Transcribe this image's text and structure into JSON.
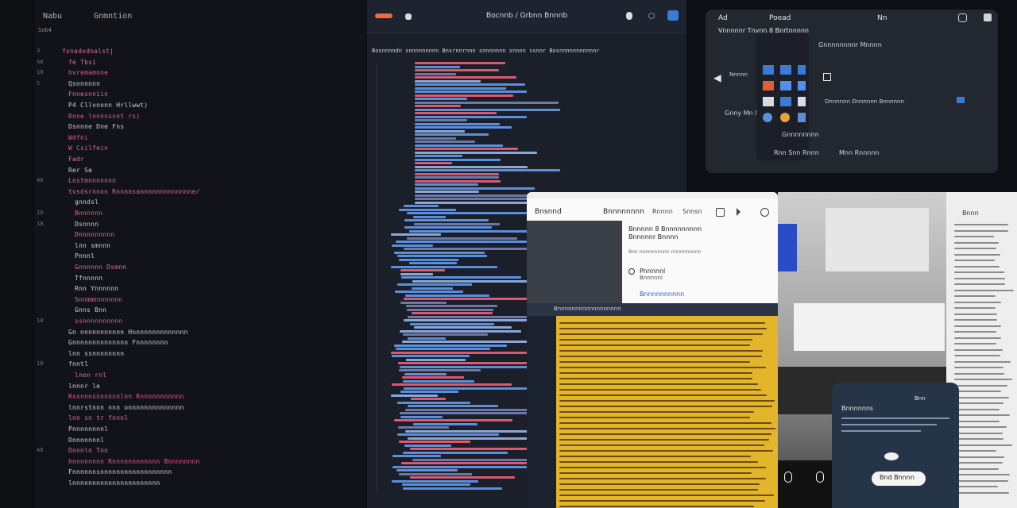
{
  "left_editor": {
    "tabs": [
      "Nabu",
      "Gnmntion"
    ],
    "gutter_top": "Sob4",
    "lines": [
      {
        "ln": "3",
        "t": "fxnadxdnalst|",
        "c": "#d86ca1",
        "i": 0
      },
      {
        "ln": "48",
        "t": "fe Tbsi",
        "c": "#d86ca1",
        "i": 1
      },
      {
        "ln": "18",
        "t": "hvremamnne",
        "c": "#e8578b",
        "i": 1
      },
      {
        "ln": "5",
        "t": "Qsnnnnnn",
        "c": "#c9ccd4",
        "i": 1
      },
      {
        "ln": "",
        "t": "Fnnesnniin",
        "c": "#d86ca1",
        "i": 1
      },
      {
        "ln": "",
        "t": "P4 Cllvnonn Hrllwwt)",
        "c": "#c9ccd4",
        "i": 1
      },
      {
        "ln": "",
        "t": "Rnne lnnnnsnnt rs)",
        "c": "#e8578b",
        "i": 1
      },
      {
        "ln": "",
        "t": "Dsnnne Dne Fns",
        "c": "#c9ccd4",
        "i": 1
      },
      {
        "ln": "",
        "t": "Wdfni",
        "c": "#e8578b",
        "i": 1
      },
      {
        "ln": "",
        "t": "W Csilfecn",
        "c": "#e8578b",
        "i": 1
      },
      {
        "ln": "",
        "t": "Fadr",
        "c": "#d86ca1",
        "i": 1
      },
      {
        "ln": "",
        "t": "Rer Se",
        "c": "#c9ccd4",
        "i": 1
      },
      {
        "ln": "48",
        "t": "Lnstmnnnnnnn",
        "c": "#d86ca1",
        "i": 1
      },
      {
        "ln": "",
        "t": "tvsdsrnnnn Rnnnnsannnnnnnnnnnnne/",
        "c": "#d86ca1",
        "i": 1
      },
      {
        "ln": "",
        "t": "gnndsl",
        "c": "#c9ccd4",
        "i": 2
      },
      {
        "ln": "10",
        "t": "Bnnnnnn",
        "c": "#e8578b",
        "i": 2
      },
      {
        "ln": "18",
        "t": "Dsnnnn",
        "c": "#c9ccd4",
        "i": 2
      },
      {
        "ln": "",
        "t": "Dnnnnnnnnn",
        "c": "#d86ca1",
        "i": 2
      },
      {
        "ln": "",
        "t": "lnn smnnn",
        "c": "#c9ccd4",
        "i": 2
      },
      {
        "ln": "",
        "t": "Pnnnl",
        "c": "#c9ccd4",
        "i": 2
      },
      {
        "ln": "",
        "t": "Gnnnnnn Dsmnn",
        "c": "#d86ca1",
        "i": 2
      },
      {
        "ln": "",
        "t": "Tfnnnnn",
        "c": "#c9ccd4",
        "i": 2
      },
      {
        "ln": "",
        "t": "Rnn Ynnnnnn",
        "c": "#c9ccd4",
        "i": 2
      },
      {
        "ln": "",
        "t": "Snnmmnnnnnnn",
        "c": "#d86ca1",
        "i": 2
      },
      {
        "ln": "",
        "t": "Gnns Bnn",
        "c": "#c9ccd4",
        "i": 2
      },
      {
        "ln": "18",
        "t": "ssnnnnnnnnnn",
        "c": "#e8578b",
        "i": 2
      },
      {
        "ln": "",
        "t": "Gn nnnnnnnnnnn Hnnnnnnnnnnnnnn",
        "c": "#c9ccd4",
        "i": 1
      },
      {
        "ln": "",
        "t": "Gnnnnnnnnnnnnnn Fnnnnnnnn",
        "c": "#c9ccd4",
        "i": 1
      },
      {
        "ln": "",
        "t": "lnn ssnnnnnnnn",
        "c": "#c9ccd4",
        "i": 1
      },
      {
        "ln": "18",
        "t": "fnntl",
        "c": "#c9ccd4",
        "i": 1
      },
      {
        "ln": "",
        "t": "lnen rnl",
        "c": "#d86ca1",
        "i": 2
      },
      {
        "ln": "",
        "t": "lnnnr le",
        "c": "#c9ccd4",
        "i": 1
      },
      {
        "ln": "",
        "t": "Rssnnnsnnnnnnlnn Rnnnnnnnnnnn",
        "c": "#e8578b",
        "i": 1
      },
      {
        "ln": "",
        "t": "lnnrstnnn nnn onnnnnnnnnnnnnn",
        "c": "#c9ccd4",
        "i": 1
      },
      {
        "ln": "",
        "t": "lnn sn tr fnnnl",
        "c": "#d86ca1",
        "i": 1
      },
      {
        "ln": "",
        "t": "Pnnnnnnnnl",
        "c": "#c9ccd4",
        "i": 1
      },
      {
        "ln": "",
        "t": "Dnnnnnnnl",
        "c": "#c9ccd4",
        "i": 1
      },
      {
        "ln": "48",
        "t": "Dnnnln Tnn",
        "c": "#d86ca1",
        "i": 1
      },
      {
        "ln": "",
        "t": "hnnnnnnnn Rnnnnnnnnnnnn Bnnnnnnnn",
        "c": "#e8578b",
        "i": 1
      },
      {
        "ln": "",
        "t": "Fnnnnnnsnnnnnnnnnnnnnnnnnn",
        "c": "#c9ccd4",
        "i": 1
      },
      {
        "ln": "",
        "t": "lnnnnnnnnnnnnnnnnnnnnnn",
        "c": "#c9ccd4",
        "i": 1
      }
    ]
  },
  "middle_editor": {
    "title": "Bocnnb / Grbnn Bnnnb",
    "breadcrumb": "Bosnnnndn snnnnnnnnn Bnsrnnrnnn snnnnnnn snnnn ssnnr  Bosnnnnnnnnnnnr"
  },
  "settings_panel": {
    "header_left": "Ad",
    "header_mid": "Poead",
    "header_right": "Nn",
    "subtitle": "Vnnnnnr Tnvnn 8 Bnrtnnnnn",
    "section_title": "Gnnnnnnnnr Mnnnn",
    "row_label": "Gnny Mn 8",
    "toggle_label": "Nnnnn",
    "list_item": "Dnnnnnn Dnnnnnn Bnnnnnn",
    "group_label": "Gnnnnnnnn",
    "footer_left": "Rnn Snn Rnnn",
    "footer_right": "Mnn Rnnnnn"
  },
  "dialog_card": {
    "back_label": "Bnsnnd",
    "title": "Bnnnnnnnn",
    "tab_a": "Rnnnn",
    "tab_b": "Snnsn",
    "heading": "Bnnnnn 8 Bnnnnnnnnn",
    "subheading": "Bnnnnnr Bnnnn",
    "note": "Bnn nnnnnnnnnn nnnnnnnnnn",
    "option_label": "Pnnnnnl",
    "option_sub": "Bnnnnnl",
    "link": "Bnnnnnnnnnn",
    "bottom_strip": "Bnnnnnnnnnnnnnnnnnn"
  },
  "phone_popup": {
    "title": "Bnnnnnns",
    "badge": "Bnn",
    "action": "Bnd  Bnnnn"
  },
  "right_doc": {
    "title": "Bnnn"
  },
  "colors": {
    "accent_orange": "#f26a3d",
    "accent_blue": "#3a7bd5",
    "code_pink": "#d86ca1",
    "code_red": "#e8578b",
    "code_blue": "#5b8fd9",
    "yellow": "#e3b52a"
  }
}
